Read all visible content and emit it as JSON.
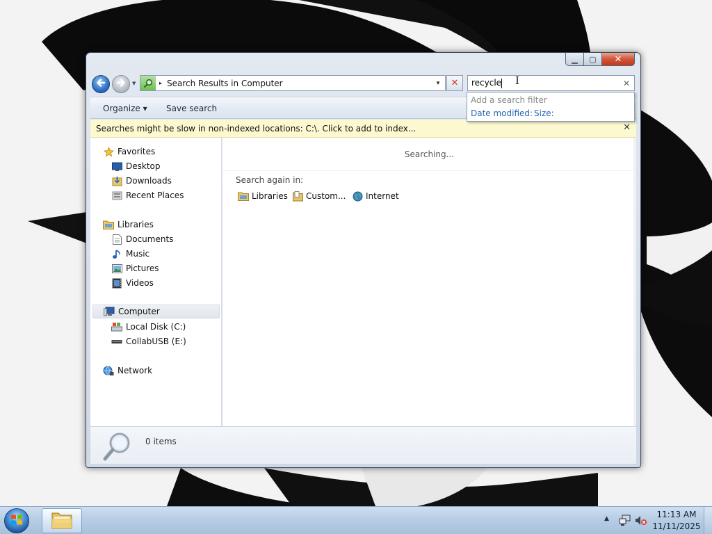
{
  "window": {
    "caption": {
      "minimize": "▁",
      "maximize": "▢",
      "close": "✕"
    },
    "address": {
      "text": "Search Results in Computer",
      "chevron": "▸",
      "dropdown": "▾"
    },
    "search": {
      "value": "recycle",
      "clear": "✕"
    },
    "suggestions": {
      "title": "Add a search filter",
      "options": [
        "Date modified:",
        "Size:"
      ]
    },
    "command_bar": {
      "organize": "Organize ▾",
      "save_search": "Save search"
    },
    "info_bar": {
      "text": "Searches might be slow in non-indexed locations: C:\\. Click to add to index...",
      "close": "✕"
    },
    "nav_pane": {
      "favorites": {
        "label": "Favorites",
        "items": [
          "Desktop",
          "Downloads",
          "Recent Places"
        ]
      },
      "libraries": {
        "label": "Libraries",
        "items": [
          "Documents",
          "Music",
          "Pictures",
          "Videos"
        ]
      },
      "computer": {
        "label": "Computer",
        "items": [
          "Local Disk (C:)",
          "CollabUSB (E:)"
        ]
      },
      "network": {
        "label": "Network"
      }
    },
    "content": {
      "status": "Searching...",
      "search_again_label": "Search again in:",
      "search_again": [
        "Libraries",
        "Custom...",
        "Internet"
      ]
    },
    "details": {
      "item_count": "0 items"
    }
  },
  "taskbar": {
    "clock_time": "11:13 AM",
    "clock_date": "11/11/2025",
    "tray_arrow": "▲"
  },
  "colors": {
    "link_blue": "#2566b3",
    "info_bar_bg": "#fcf8cf",
    "close_red": "#c7361b"
  },
  "icons": [
    "back-arrow-icon",
    "forward-arrow-icon",
    "search-folder-icon",
    "star-icon",
    "desktop-icon",
    "downloads-icon",
    "recent-places-icon",
    "libraries-icon",
    "document-icon",
    "music-icon",
    "pictures-icon",
    "videos-icon",
    "computer-icon",
    "local-disk-icon",
    "usb-drive-icon",
    "network-icon",
    "custom-folder-icon",
    "internet-globe-icon",
    "magnifier-icon",
    "windows-logo-icon",
    "explorer-folder-icon",
    "network-tray-icon",
    "volume-muted-icon"
  ]
}
